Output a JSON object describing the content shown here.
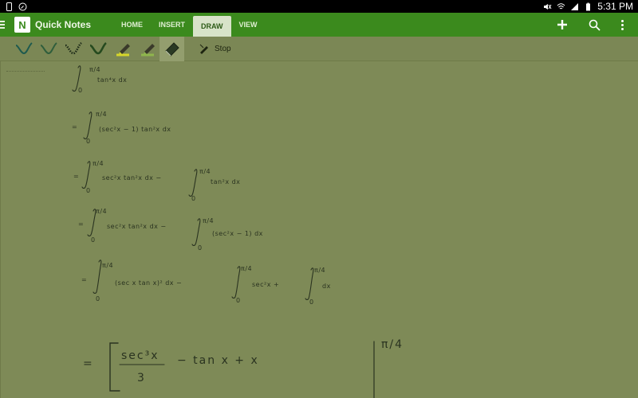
{
  "status_bar": {
    "time": "5:31 PM",
    "left_icons": [
      "phone-frame-icon",
      "compass-icon"
    ],
    "right_icons": [
      "mute-icon",
      "wifi-icon",
      "signal-icon",
      "battery-icon"
    ]
  },
  "app_bar": {
    "title": "Quick Notes",
    "logo_letter": "N",
    "tabs": [
      {
        "label": "HOME",
        "active": false
      },
      {
        "label": "INSERT",
        "active": false
      },
      {
        "label": "DRAW",
        "active": true
      },
      {
        "label": "VIEW",
        "active": false
      }
    ],
    "actions": [
      "plus-icon",
      "search-icon",
      "overflow-menu-icon"
    ]
  },
  "toolbar": {
    "tools": [
      "pen-teal",
      "pen-green",
      "pen-dotted",
      "pen-dark-green",
      "highlighter-yellow",
      "highlighter-green",
      "eraser"
    ],
    "selected_tool": "eraser",
    "stop_label": "Stop"
  },
  "note": {
    "lines": [
      {
        "prefix": "",
        "lower": "0",
        "upper": "π/4",
        "expr": "tan⁴x dx"
      },
      {
        "prefix": "=",
        "lower": "0",
        "upper": "π/4",
        "expr": "(sec²x − 1) tan²x dx"
      },
      {
        "prefix": "=",
        "lower": "0",
        "upper": "π/4",
        "expr": "sec²x tan²x dx  −",
        "lower2": "0",
        "upper2": "π/4",
        "expr2": "tan²x dx"
      },
      {
        "prefix": "=",
        "lower": "0",
        "upper": "π/4",
        "expr": "sec²x tan²x dx  −",
        "lower2": "0",
        "upper2": "π/4",
        "expr2": "(sec²x − 1) dx"
      },
      {
        "prefix": "=",
        "lower": "0",
        "upper": "π/4",
        "expr": "(sec x tan x)² dx  −",
        "lower2": "0",
        "upper2": "π/4",
        "expr2": "sec²x  +",
        "lower3": "0",
        "upper3": "π/4",
        "expr3": "dx"
      }
    ],
    "final": {
      "prefix": "=",
      "numerator": "sec³x",
      "denominator": "3",
      "rest": "−   tan x    + x",
      "upper": "π/4"
    }
  },
  "colors": {
    "status_bar": "#000000",
    "app_bar": "#3b8a1d",
    "active_tab": "#d8e3c9",
    "canvas": "#7e8a57",
    "ink": "#2a3320"
  }
}
